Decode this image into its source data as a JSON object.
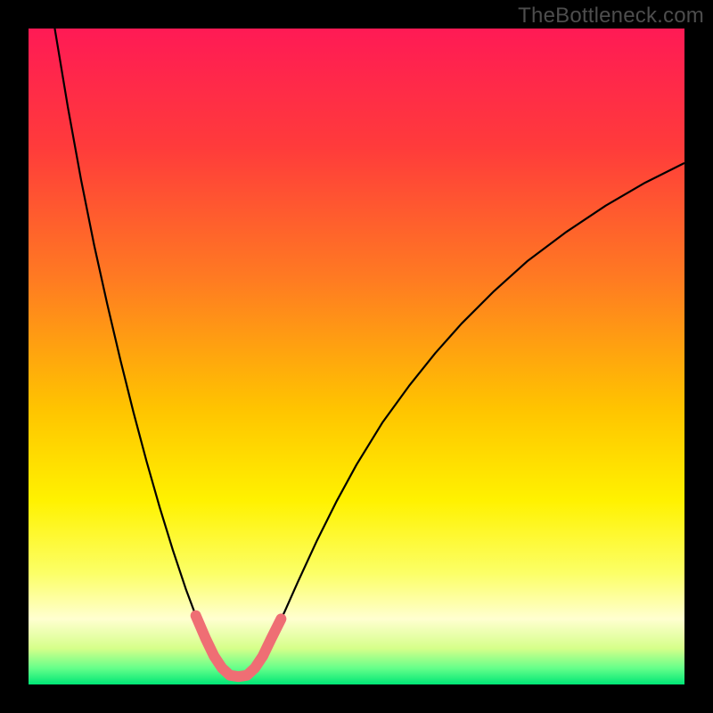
{
  "watermark": "TheBottleneck.com",
  "chart_data": {
    "type": "line",
    "title": "",
    "xlabel": "",
    "ylabel": "",
    "xlim": [
      0,
      100
    ],
    "ylim": [
      0,
      100
    ],
    "grid": false,
    "legend": false,
    "gradient_stops": [
      {
        "offset": 0.0,
        "color": "#ff1a55"
      },
      {
        "offset": 0.18,
        "color": "#ff3b3b"
      },
      {
        "offset": 0.38,
        "color": "#ff7a22"
      },
      {
        "offset": 0.58,
        "color": "#ffc400"
      },
      {
        "offset": 0.72,
        "color": "#fff200"
      },
      {
        "offset": 0.83,
        "color": "#fcff66"
      },
      {
        "offset": 0.9,
        "color": "#ffffd0"
      },
      {
        "offset": 0.945,
        "color": "#d6ff8a"
      },
      {
        "offset": 0.975,
        "color": "#66ff8a"
      },
      {
        "offset": 1.0,
        "color": "#00e676"
      }
    ],
    "series": [
      {
        "name": "bottleneck-curve",
        "stroke": "#000000",
        "stroke_width": 2.2,
        "points": [
          {
            "x": 4.0,
            "y": 100.0
          },
          {
            "x": 6.0,
            "y": 88.0
          },
          {
            "x": 8.0,
            "y": 77.0
          },
          {
            "x": 10.0,
            "y": 67.0
          },
          {
            "x": 12.0,
            "y": 58.0
          },
          {
            "x": 14.0,
            "y": 49.5
          },
          {
            "x": 16.0,
            "y": 41.5
          },
          {
            "x": 18.0,
            "y": 34.0
          },
          {
            "x": 20.0,
            "y": 27.0
          },
          {
            "x": 22.0,
            "y": 20.5
          },
          {
            "x": 24.0,
            "y": 14.5
          },
          {
            "x": 25.5,
            "y": 10.5
          },
          {
            "x": 27.0,
            "y": 7.0
          },
          {
            "x": 28.3,
            "y": 4.3
          },
          {
            "x": 29.5,
            "y": 2.5
          },
          {
            "x": 30.7,
            "y": 1.4
          },
          {
            "x": 32.0,
            "y": 1.2
          },
          {
            "x": 33.3,
            "y": 1.4
          },
          {
            "x": 34.5,
            "y": 2.5
          },
          {
            "x": 35.7,
            "y": 4.3
          },
          {
            "x": 37.0,
            "y": 7.0
          },
          {
            "x": 39.0,
            "y": 11.0
          },
          {
            "x": 41.0,
            "y": 15.5
          },
          {
            "x": 44.0,
            "y": 22.0
          },
          {
            "x": 47.0,
            "y": 28.0
          },
          {
            "x": 50.0,
            "y": 33.5
          },
          {
            "x": 54.0,
            "y": 40.0
          },
          {
            "x": 58.0,
            "y": 45.5
          },
          {
            "x": 62.0,
            "y": 50.5
          },
          {
            "x": 66.0,
            "y": 55.0
          },
          {
            "x": 71.0,
            "y": 60.0
          },
          {
            "x": 76.0,
            "y": 64.5
          },
          {
            "x": 82.0,
            "y": 69.0
          },
          {
            "x": 88.0,
            "y": 73.0
          },
          {
            "x": 94.0,
            "y": 76.5
          },
          {
            "x": 100.0,
            "y": 79.5
          }
        ]
      },
      {
        "name": "optimal-band-highlight",
        "stroke": "#ef6e74",
        "stroke_width": 12,
        "stroke_linecap": "round",
        "points": [
          {
            "x": 25.5,
            "y": 10.5
          },
          {
            "x": 27.0,
            "y": 7.0
          },
          {
            "x": 28.3,
            "y": 4.3
          },
          {
            "x": 29.5,
            "y": 2.5
          },
          {
            "x": 30.7,
            "y": 1.4
          },
          {
            "x": 32.0,
            "y": 1.2
          },
          {
            "x": 33.3,
            "y": 1.4
          },
          {
            "x": 34.5,
            "y": 2.5
          },
          {
            "x": 35.7,
            "y": 4.3
          },
          {
            "x": 37.0,
            "y": 7.0
          },
          {
            "x": 38.5,
            "y": 10.0
          }
        ]
      }
    ]
  }
}
